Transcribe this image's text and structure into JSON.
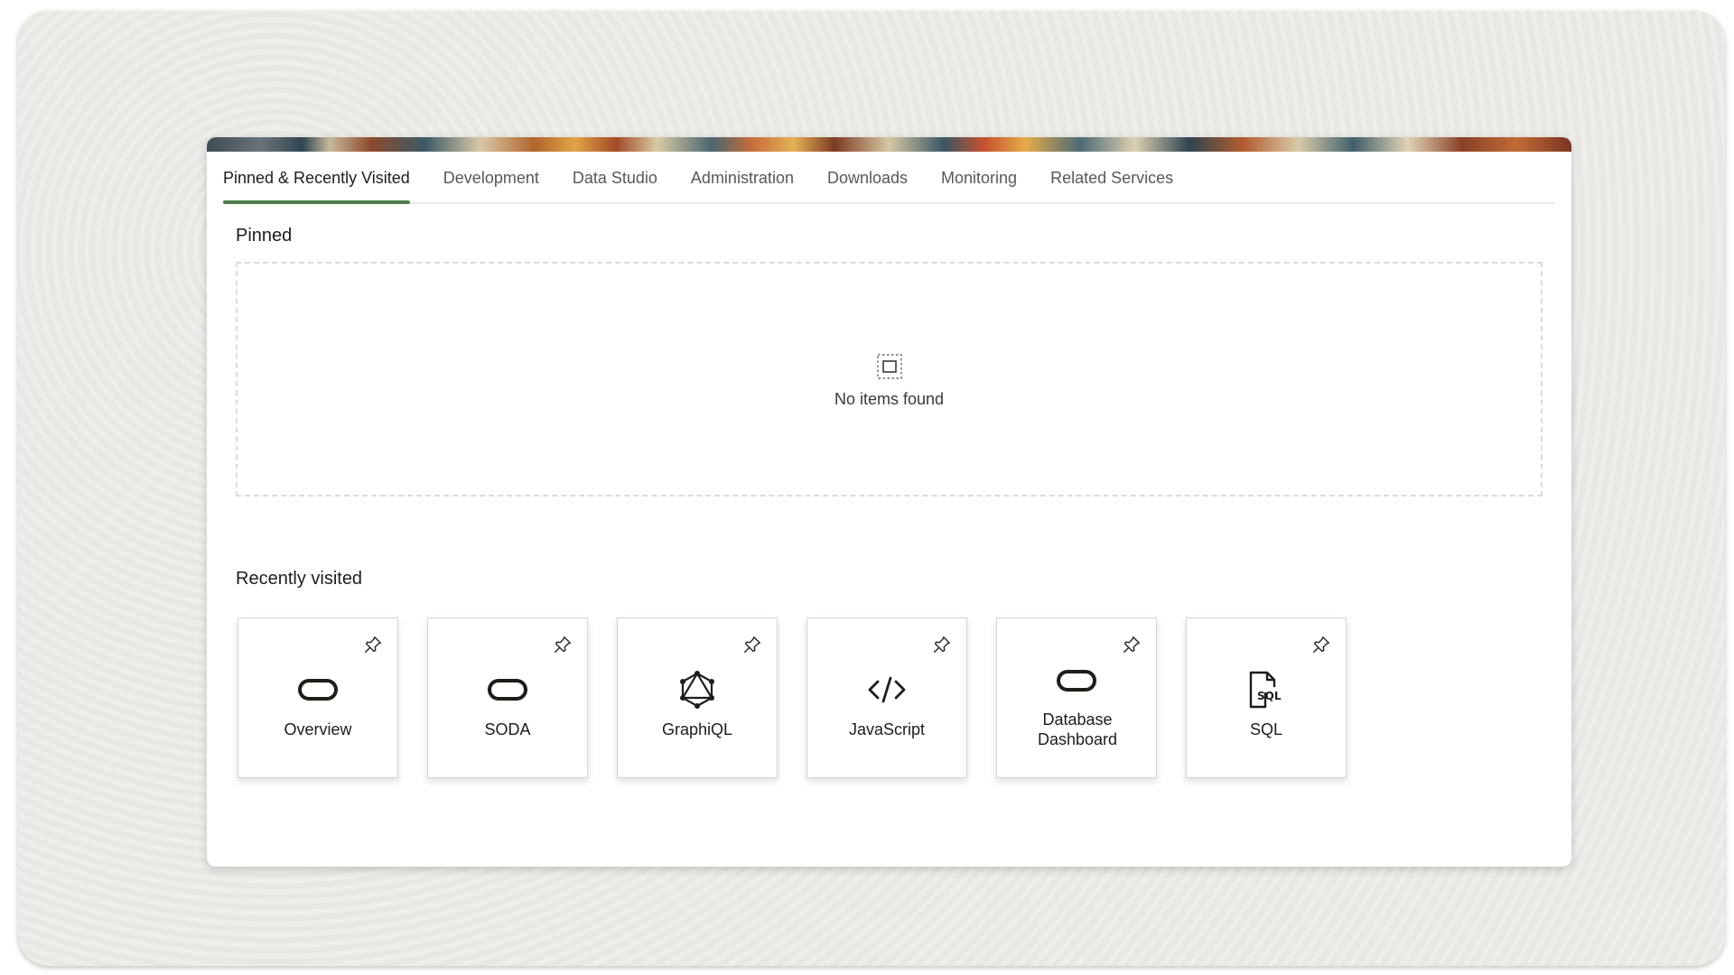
{
  "tabs": [
    {
      "label": "Pinned & Recently Visited",
      "active": true
    },
    {
      "label": "Development",
      "active": false
    },
    {
      "label": "Data Studio",
      "active": false
    },
    {
      "label": "Administration",
      "active": false
    },
    {
      "label": "Downloads",
      "active": false
    },
    {
      "label": "Monitoring",
      "active": false
    },
    {
      "label": "Related Services",
      "active": false
    }
  ],
  "pinned": {
    "title": "Pinned",
    "empty_text": "No items found"
  },
  "recent": {
    "title": "Recently visited",
    "items": [
      {
        "label": "Overview",
        "icon": "oracle-pill-icon"
      },
      {
        "label": "SODA",
        "icon": "oracle-pill-icon"
      },
      {
        "label": "GraphiQL",
        "icon": "graphql-icon"
      },
      {
        "label": "JavaScript",
        "icon": "code-brackets-icon"
      },
      {
        "label": "Database Dashboard",
        "icon": "oracle-pill-icon"
      },
      {
        "label": "SQL",
        "icon": "sql-file-icon"
      }
    ]
  },
  "colors": {
    "active_tab_underline": "#4f7d4a",
    "text_primary": "#1f1d1a",
    "text_secondary": "#5a5753"
  }
}
